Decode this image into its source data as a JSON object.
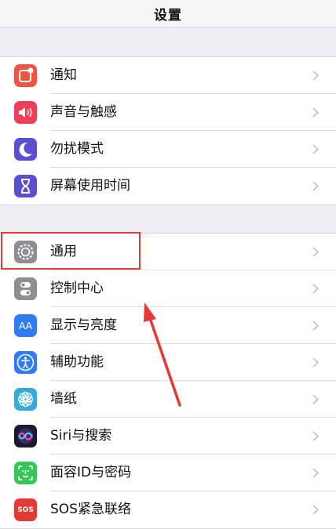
{
  "nav": {
    "title": "设置"
  },
  "group1": [
    {
      "label": "通知",
      "icon": "notifications-icon",
      "color": "#f05442"
    },
    {
      "label": "声音与触感",
      "icon": "sound-icon",
      "color": "#ef3e55"
    },
    {
      "label": "勿扰模式",
      "icon": "moon-icon",
      "color": "#5b4fcf"
    },
    {
      "label": "屏幕使用时间",
      "icon": "hourglass-icon",
      "color": "#5b4fcf"
    }
  ],
  "group2": [
    {
      "label": "通用",
      "icon": "gear-icon",
      "color": "#8e8e93"
    },
    {
      "label": "控制中心",
      "icon": "control-center-icon",
      "color": "#8e8e93"
    },
    {
      "label": "显示与亮度",
      "icon": "display-brightness-icon",
      "color": "#2f7cf6",
      "icon_text": "AA"
    },
    {
      "label": "辅助功能",
      "icon": "accessibility-icon",
      "color": "#2f7cf6"
    },
    {
      "label": "墙纸",
      "icon": "wallpaper-icon",
      "color": "#38a8d8"
    },
    {
      "label": "Siri与搜索",
      "icon": "siri-icon",
      "color": "#1a1a2e"
    },
    {
      "label": "面容ID与密码",
      "icon": "face-id-icon",
      "color": "#35c759"
    },
    {
      "label": "SOS紧急联络",
      "icon": "sos-icon",
      "color": "#e53935",
      "icon_text": "SOS"
    }
  ],
  "annotation": {
    "color": "#e53935"
  }
}
